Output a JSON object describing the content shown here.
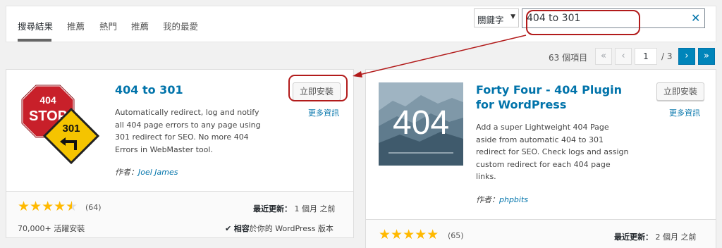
{
  "tabs": [
    {
      "label": "搜尋結果"
    },
    {
      "label": "推薦"
    },
    {
      "label": "熱門"
    },
    {
      "label": "推薦"
    },
    {
      "label": "我的最愛"
    }
  ],
  "search": {
    "type_select": "關鍵字",
    "query": "404 to 301",
    "clear_icon": "close-icon"
  },
  "pagination": {
    "items_count": "63 個項目",
    "first": "«",
    "prev": "‹",
    "current_page": "1",
    "total": "/ 3",
    "next": "›",
    "last": "»"
  },
  "plugins": [
    {
      "title": "404 to 301",
      "description": "Automatically redirect, log and notify all 404 page errors to any page using 301 redirect for SEO. No more 404 Errors in WebMaster tool.",
      "author_prefix": "作者：",
      "author": "Joel James",
      "install_label": "立即安裝",
      "more_label": "更多資訊",
      "rating": 4.5,
      "rating_count": "(64)",
      "installs": "70,000+ 活躍安裝",
      "last_updated_label": "最近更新：",
      "last_updated": "1 個月 之前",
      "compat_check": "✔",
      "compat_label": "相容",
      "compat_text": "於你的 WordPress 版本",
      "icon_text": [
        "404",
        "STOP",
        "301"
      ]
    },
    {
      "title": "Forty Four - 404 Plugin for WordPress",
      "description": "Add a super Lightweight 404 Page aside from automatic 404 to 301 redirect for SEO. Check logs and assign custom redirect for each 404 page links.",
      "author_prefix": "作者：",
      "author": "phpbits",
      "install_label": "立即安裝",
      "more_label": "更多資訊",
      "rating": 5,
      "rating_count": "(65)",
      "last_updated_label": "最近更新：",
      "last_updated": "2 個月 之前",
      "thumb_text": "404"
    }
  ],
  "colors": {
    "link": "#0073aa",
    "star": "#ffb900",
    "annotation": "#b21b1b",
    "page_bg": "#f1f1f1"
  }
}
